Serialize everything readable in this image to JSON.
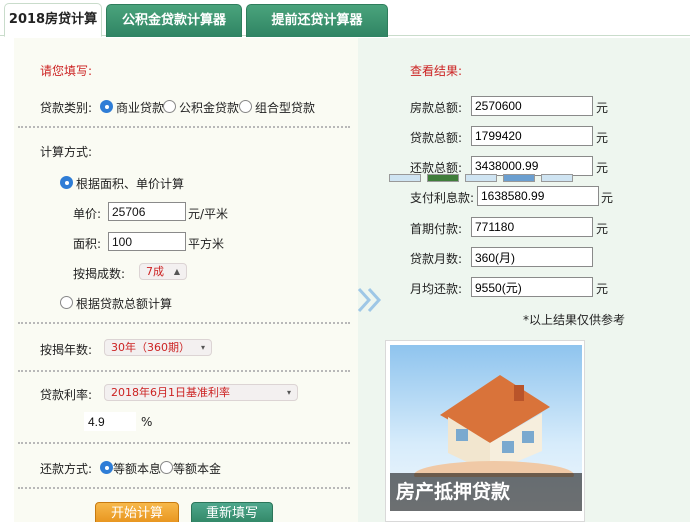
{
  "tabs": [
    "2018房贷计算器",
    "公积金贷款计算器",
    "提前还贷计算器"
  ],
  "form": {
    "heading": "请您填写:",
    "loan_type_label": "贷款类别:",
    "loan_types": [
      "商业贷款",
      "公积金贷款",
      "组合型贷款"
    ],
    "calc_method_label": "计算方式:",
    "method_area": "根据面积、单价计算",
    "unit_price_label": "单价:",
    "unit_price_value": "25706",
    "unit_price_unit": "元/平米",
    "area_label": "面积:",
    "area_value": "100",
    "area_unit": "平方米",
    "ratio_label": "按揭成数:",
    "ratio_value": "7成",
    "method_total": "根据贷款总额计算",
    "years_label": "按揭年数:",
    "years_value": "30年（360期）",
    "rate_label": "贷款利率:",
    "rate_value": "2018年6月1日基准利率",
    "rate_number": "4.9",
    "rate_unit": "%",
    "repay_label": "还款方式:",
    "repay_options": [
      "等额本息",
      "等额本金"
    ],
    "start_button": "开始计算",
    "reset_button": "重新填写"
  },
  "results": {
    "heading": "查看结果:",
    "rows": [
      {
        "label": "房款总额:",
        "value": "2570600",
        "unit": "元"
      },
      {
        "label": "贷款总额:",
        "value": "1799420",
        "unit": "元"
      },
      {
        "label": "还款总额:",
        "value": "3438000.99",
        "unit": "元"
      },
      {
        "label": "支付利息款:",
        "value": "1638580.99",
        "unit": "元"
      },
      {
        "label": "首期付款:",
        "value": "771180",
        "unit": "元"
      },
      {
        "label": "贷款月数:",
        "value": "360(月)",
        "unit": ""
      },
      {
        "label": "月均还款:",
        "value": "9550(元)",
        "unit": "元"
      }
    ],
    "note": "*以上结果仅供参考"
  },
  "promo": {
    "title": "房产抵押贷款"
  },
  "icons": {
    "arrow": "double-chevron-right-icon",
    "select_arrow": "up-down-arrow-icon"
  },
  "colors": {
    "tab_green": "#2f8463",
    "accent_red": "#cc2222",
    "radio_blue": "#2f7dd6",
    "start_orange": "#e6911a"
  }
}
